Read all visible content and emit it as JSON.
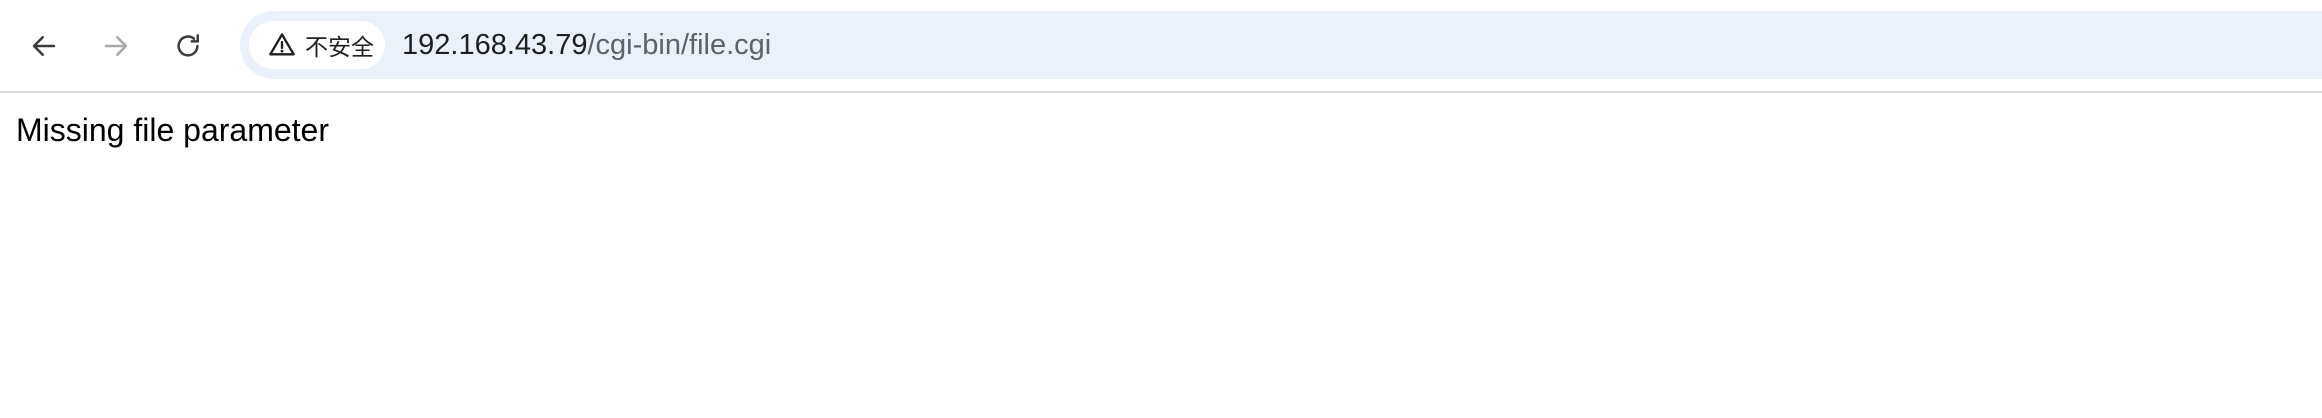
{
  "browser": {
    "nav": {
      "back_icon": "arrow-left-icon",
      "forward_icon": "arrow-right-icon",
      "reload_icon": "reload-icon",
      "forward_enabled": false
    },
    "omnibox": {
      "security_icon": "warning-triangle-icon",
      "security_label": "不安全",
      "url_host": "192.168.43.79",
      "url_path": "/cgi-bin/file.cgi"
    }
  },
  "page": {
    "body_text": "Missing file parameter"
  },
  "colors": {
    "omnibox_bg": "#eaf1fb",
    "chip_bg": "#ffffff",
    "icon_active": "#3c3c3c",
    "icon_disabled": "#a8a8a8"
  }
}
